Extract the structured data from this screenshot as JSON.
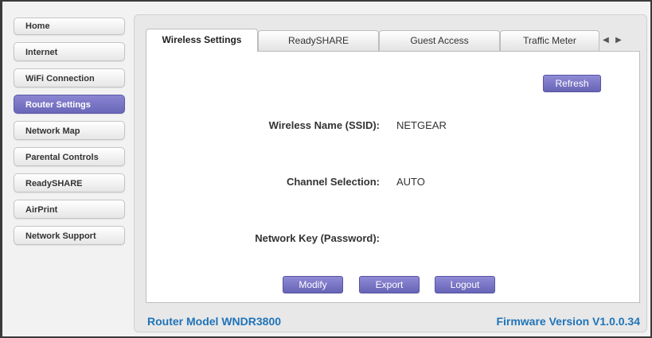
{
  "sidebar": {
    "items": [
      {
        "label": "Home"
      },
      {
        "label": "Internet"
      },
      {
        "label": "WiFi Connection"
      },
      {
        "label": "Router Settings",
        "active": true
      },
      {
        "label": "Network Map"
      },
      {
        "label": "Parental Controls"
      },
      {
        "label": "ReadySHARE"
      },
      {
        "label": "AirPrint"
      },
      {
        "label": "Network Support"
      }
    ]
  },
  "tabs": [
    {
      "label": "Wireless Settings",
      "active": true
    },
    {
      "label": "ReadySHARE"
    },
    {
      "label": "Guest Access"
    },
    {
      "label": "Traffic Meter"
    }
  ],
  "tab_scroll": {
    "left_icon": "left-arrow-icon",
    "right_icon": "right-arrow-icon",
    "left_glyph": "◀",
    "right_glyph": "▶"
  },
  "main": {
    "refresh_label": "Refresh",
    "fields": [
      {
        "label": "Wireless Name (SSID):",
        "value": "NETGEAR"
      },
      {
        "label": "Channel Selection:",
        "value": "AUTO"
      },
      {
        "label": "Network Key (Password):",
        "value": ""
      }
    ],
    "buttons": {
      "modify": "Modify",
      "export": "Export",
      "logout": "Logout"
    }
  },
  "footer": {
    "model": "Router Model WNDR3800",
    "firmware": "Firmware Version V1.0.0.34"
  },
  "colors": {
    "accent": "#6f6bbd",
    "footer_text": "#1e73b8"
  }
}
